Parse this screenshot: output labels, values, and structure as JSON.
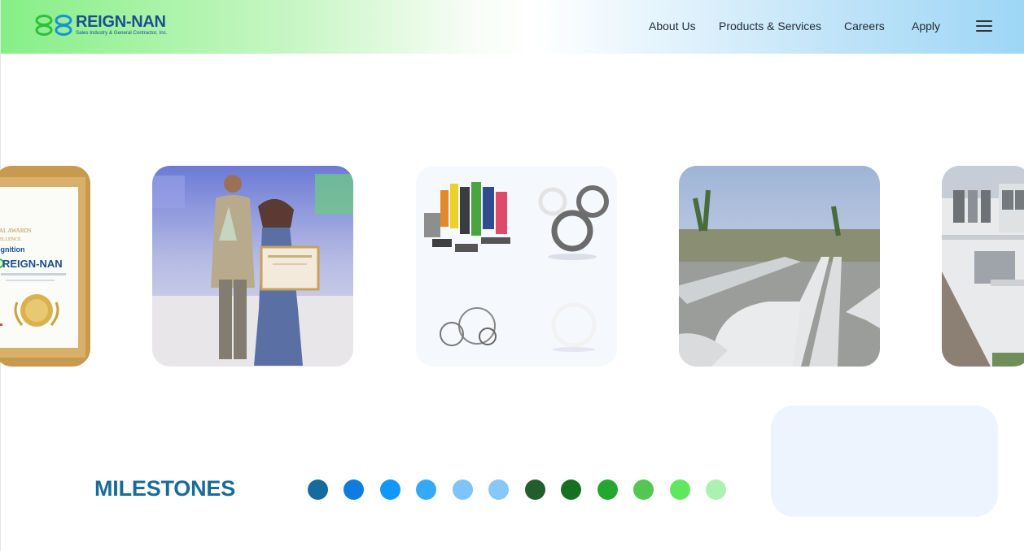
{
  "brand": {
    "name": "REIGN-NAN",
    "tagline": "Sales Industry & General Contractor, Inc.",
    "colors": {
      "green": "#2fbf3b",
      "blue": "#1b4f8f"
    }
  },
  "nav": {
    "items": [
      {
        "label": "About Us"
      },
      {
        "label": "Products & Services"
      },
      {
        "label": "Careers"
      },
      {
        "label": "Apply"
      }
    ],
    "menu_icon": "hamburger-icon"
  },
  "carousel": {
    "cards": [
      {
        "name": "award-plaque-image",
        "plaque_text": "REIGN-NAN",
        "plaque_caption": "ognition"
      },
      {
        "name": "award-ceremony-image"
      },
      {
        "name": "products-seals-image"
      },
      {
        "name": "pipeline-image"
      },
      {
        "name": "building-image"
      }
    ]
  },
  "milestones": {
    "title": "MILESTONES",
    "dot_colors": [
      "#146b9c",
      "#0f7de0",
      "#1196f9",
      "#35a8f8",
      "#7cc4f9",
      "#87c7f9",
      "#215e2c",
      "#157020",
      "#23a82f",
      "#54c653",
      "#5fe85f",
      "#abf2b0"
    ]
  }
}
